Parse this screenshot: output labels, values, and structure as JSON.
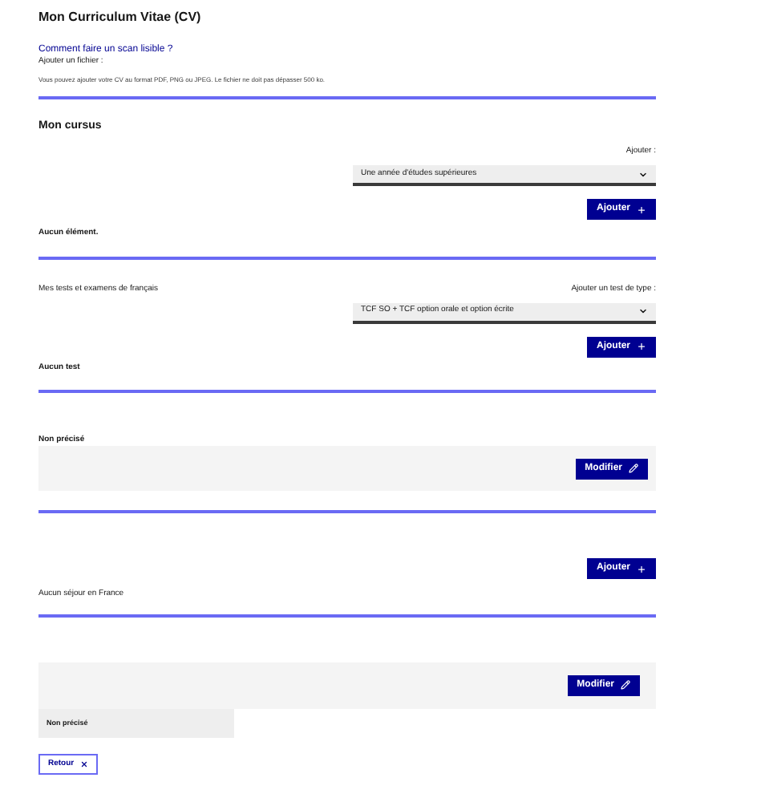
{
  "cv": {
    "title": "Mon Curriculum Vitae (CV)",
    "help_link": "Comment faire un scan lisible ?",
    "file_label": "Ajouter un fichier :",
    "note": "Vous pouvez ajouter votre CV au format PDF, PNG ou JPEG. Le fichier ne doit pas dépasser 500 ko."
  },
  "cursus": {
    "title": "Mon cursus",
    "select_label": "Ajouter :",
    "select_value": "Une année d'études supérieures",
    "button": "Ajouter",
    "empty": "Aucun élément."
  },
  "tests": {
    "title": "Mes tests et examens de français",
    "select_label": "Ajouter un test de type :",
    "select_value": "TCF SO + TCF option orale et option écrite",
    "button": "Ajouter",
    "empty": "Aucun test"
  },
  "status": {
    "label": "Non précisé",
    "button": "Modifier"
  },
  "stays": {
    "button": "Ajouter",
    "empty": "Aucun séjour en France"
  },
  "other": {
    "button": "Modifier",
    "value": "Non précisé"
  },
  "back_button": "Retour"
}
